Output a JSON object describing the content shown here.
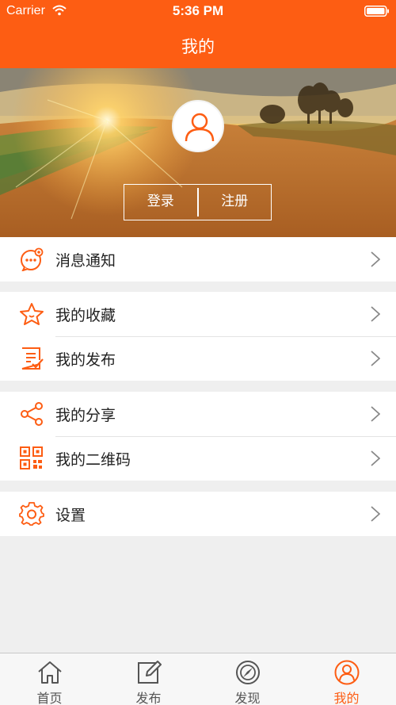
{
  "status_bar": {
    "carrier": "Carrier",
    "time": "5:36 PM"
  },
  "nav": {
    "title": "我的"
  },
  "profile": {
    "login_label": "登录",
    "register_label": "注册"
  },
  "menu": {
    "groups": [
      [
        {
          "label": "消息通知",
          "icon": "message-icon"
        }
      ],
      [
        {
          "label": "我的收藏",
          "icon": "star-icon"
        },
        {
          "label": "我的发布",
          "icon": "edit-document-icon"
        }
      ],
      [
        {
          "label": "我的分享",
          "icon": "share-icon"
        },
        {
          "label": "我的二维码",
          "icon": "qr-code-icon"
        }
      ],
      [
        {
          "label": "设置",
          "icon": "gear-icon"
        }
      ]
    ]
  },
  "tabs": [
    {
      "label": "首页",
      "icon": "home-icon",
      "active": false
    },
    {
      "label": "发布",
      "icon": "compose-icon",
      "active": false
    },
    {
      "label": "发现",
      "icon": "discover-icon",
      "active": false
    },
    {
      "label": "我的",
      "icon": "user-icon",
      "active": true
    }
  ],
  "colors": {
    "accent": "#fd5d13",
    "background": "#efefef",
    "tab_inactive": "#555555"
  }
}
